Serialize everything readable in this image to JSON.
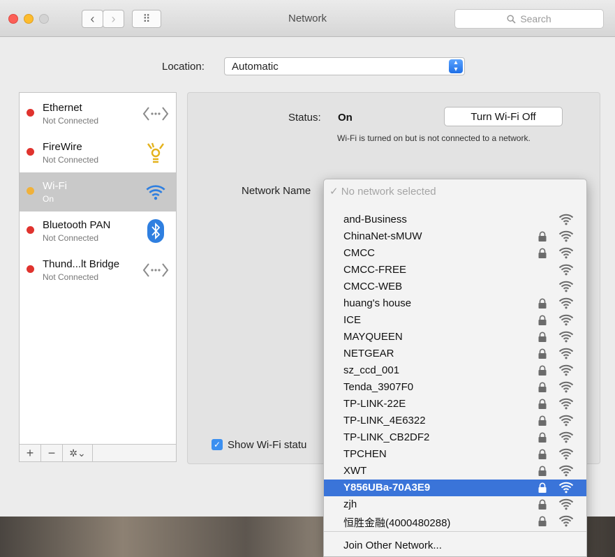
{
  "window": {
    "title": "Network",
    "search_placeholder": "Search",
    "back_label": "‹",
    "forward_label": "›",
    "grid_label": "⠿"
  },
  "location": {
    "label": "Location:",
    "value": "Automatic"
  },
  "services": [
    {
      "name": "Ethernet",
      "status": "Not Connected",
      "dot_color": "#e0332e",
      "icon": "ethernet-arrows-icon",
      "selected": false
    },
    {
      "name": "FireWire",
      "status": "Not Connected",
      "dot_color": "#e0332e",
      "icon": "firewire-icon",
      "selected": false
    },
    {
      "name": "Wi-Fi",
      "status": "On",
      "dot_color": "#f0b13a",
      "icon": "wifi-icon",
      "selected": true
    },
    {
      "name": "Bluetooth PAN",
      "status": "Not Connected",
      "dot_color": "#e0332e",
      "icon": "bluetooth-icon",
      "selected": false
    },
    {
      "name": "Thund...lt Bridge",
      "status": "Not Connected",
      "dot_color": "#e0332e",
      "icon": "thunderbolt-bridge-icon",
      "selected": false
    }
  ],
  "sidebar_toolbar": {
    "add": "+",
    "remove": "−",
    "action": "✲⌄"
  },
  "status": {
    "label": "Status:",
    "value": "On",
    "toggle_button": "Turn Wi-Fi Off",
    "description": "Wi-Fi is turned on but is not connected to a network."
  },
  "network_name": {
    "label": "Network Name",
    "current": "✓ No network selected"
  },
  "networks": [
    {
      "name": "and-Business",
      "locked": false,
      "highlighted": false
    },
    {
      "name": "ChinaNet-sMUW",
      "locked": true,
      "highlighted": false
    },
    {
      "name": "CMCC",
      "locked": true,
      "highlighted": false
    },
    {
      "name": "CMCC-FREE",
      "locked": false,
      "highlighted": false
    },
    {
      "name": "CMCC-WEB",
      "locked": false,
      "highlighted": false
    },
    {
      "name": "huang's house",
      "locked": true,
      "highlighted": false
    },
    {
      "name": "ICE",
      "locked": true,
      "highlighted": false
    },
    {
      "name": "MAYQUEEN",
      "locked": true,
      "highlighted": false
    },
    {
      "name": "NETGEAR",
      "locked": true,
      "highlighted": false
    },
    {
      "name": "sz_ccd_001",
      "locked": true,
      "highlighted": false
    },
    {
      "name": "Tenda_3907F0",
      "locked": true,
      "highlighted": false
    },
    {
      "name": "TP-LINK-22E",
      "locked": true,
      "highlighted": false
    },
    {
      "name": "TP-LINK_4E6322",
      "locked": true,
      "highlighted": false
    },
    {
      "name": "TP-LINK_CB2DF2",
      "locked": true,
      "highlighted": false
    },
    {
      "name": "TPCHEN",
      "locked": true,
      "highlighted": false
    },
    {
      "name": "XWT",
      "locked": true,
      "highlighted": false
    },
    {
      "name": "Y856UBa-70A3E9",
      "locked": true,
      "highlighted": true
    },
    {
      "name": "zjh",
      "locked": true,
      "highlighted": false
    },
    {
      "name": "恒胜金融(4000480288)",
      "locked": true,
      "highlighted": false
    }
  ],
  "join_other": "Join Other Network...",
  "show_status_label": "Show Wi-Fi statu",
  "colors": {
    "accent": "#3a74d9",
    "checkbox": "#3b8ff0",
    "dot_red": "#e0332e",
    "dot_orange": "#f0b13a",
    "wifi_blue": "#2f7fe0"
  }
}
